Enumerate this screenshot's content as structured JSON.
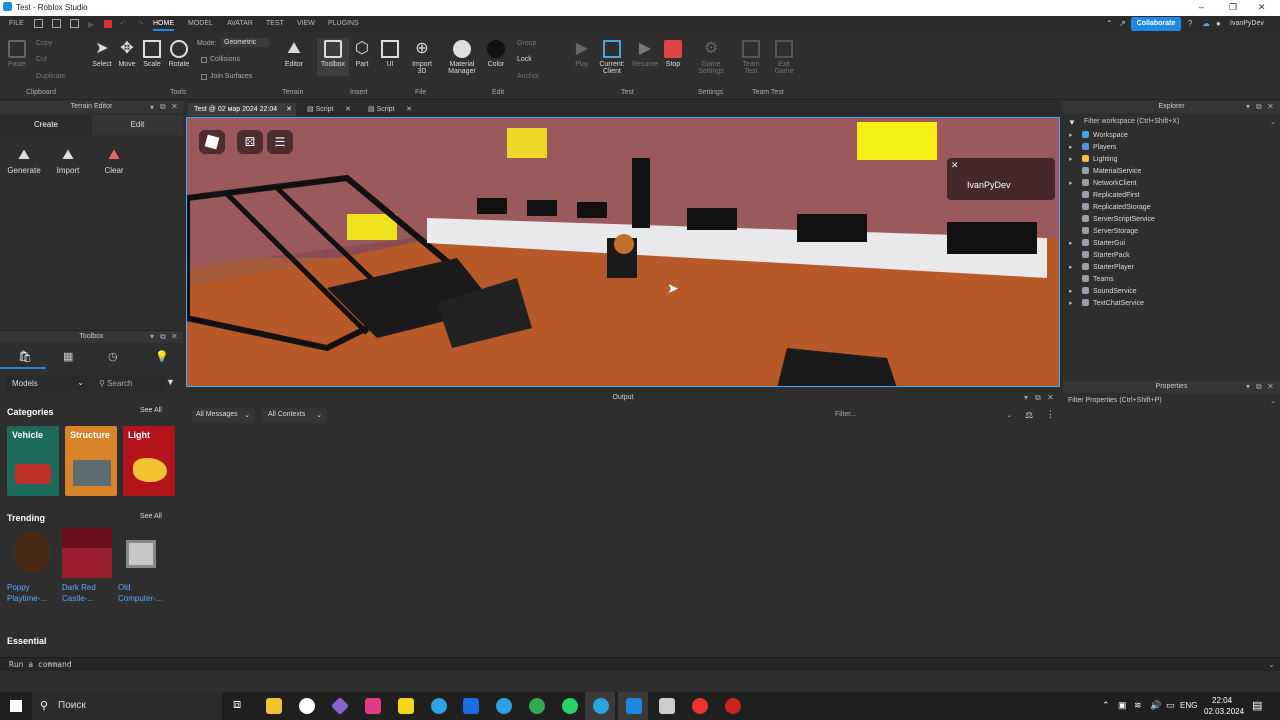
{
  "window": {
    "title": "Test - Roblox Studio",
    "user": "IvanPyDev",
    "collaborate": "Collaborate"
  },
  "menu": [
    "FILE",
    "HOME",
    "MODEL",
    "AVATAR",
    "TEST",
    "VIEW",
    "PLUGINS"
  ],
  "ribbon": {
    "clipboard": {
      "paste": "Paste",
      "copy": "Copy",
      "cut": "Cut",
      "duplicate": "Duplicate",
      "group": "Clipboard"
    },
    "tools": {
      "select": "Select",
      "move": "Move",
      "scale": "Scale",
      "rotate": "Rotate",
      "mode_label": "Mode:",
      "mode_value": "Geometric",
      "collisions": "Collisions",
      "join": "Join Surfaces",
      "group": "Tools"
    },
    "terrain": {
      "editor": "Editor",
      "group": "Terrain"
    },
    "insert": {
      "toolbox": "Toolbox",
      "part": "Part",
      "ui": "UI",
      "group": "Insert"
    },
    "file": {
      "import3d": "Import 3D",
      "group": "File"
    },
    "edit": {
      "material": "Material Manager",
      "color": "Color",
      "group_btn": "Group",
      "lock": "Lock",
      "anchor": "Anchor",
      "group": "Edit"
    },
    "test": {
      "play": "Play",
      "current": "Current: Client",
      "resume": "Resume",
      "stop": "Stop",
      "group": "Test"
    },
    "settings": {
      "game": "Game Settings",
      "group": "Settings"
    },
    "teamtest": {
      "team": "Team Test",
      "exit": "Exit Game",
      "group": "Team Test"
    }
  },
  "terrain_editor": {
    "title": "Terrain Editor",
    "tabs": [
      "Create",
      "Edit"
    ],
    "actions": [
      "Generate",
      "Import",
      "Clear"
    ]
  },
  "toolbox": {
    "title": "Toolbox",
    "category_select": "Models",
    "search_placeholder": "Search",
    "categories_label": "Categories",
    "see_all": "See All",
    "categories": [
      {
        "name": "Vehicle",
        "color": "#1e6b5c"
      },
      {
        "name": "Structure",
        "color": "#d9832b"
      },
      {
        "name": "Light",
        "color": "#b3141c"
      }
    ],
    "trending_label": "Trending",
    "trending": [
      {
        "line1": "Poppy",
        "line2": "Playtime-..."
      },
      {
        "line1": "Dark Red",
        "line2": "Castle-..."
      },
      {
        "line1": "Old",
        "line2": "Computer-..."
      }
    ],
    "essential_label": "Essential"
  },
  "doc_tabs": [
    "Test @ 02 мар 2024 22:04",
    "Script",
    "Script"
  ],
  "viewport": {
    "player_name": "IvanPyDev"
  },
  "output": {
    "title": "Output",
    "filter_messages": "All Messages",
    "filter_contexts": "All Contexts",
    "filter_placeholder": "Filter..."
  },
  "explorer": {
    "title": "Explorer",
    "filter": "Filter workspace (Ctrl+Shift+X)",
    "items": [
      {
        "label": "Workspace",
        "color": "#4aa3df",
        "expand": true
      },
      {
        "label": "Players",
        "color": "#5a8fd8",
        "expand": true
      },
      {
        "label": "Lighting",
        "color": "#f2c230",
        "expand": true
      },
      {
        "label": "MaterialService",
        "color": "#9aa0a6",
        "expand": false
      },
      {
        "label": "NetworkClient",
        "color": "#9aa0a6",
        "expand": true
      },
      {
        "label": "ReplicatedFirst",
        "color": "#9aa0a6",
        "expand": false
      },
      {
        "label": "ReplicatedStorage",
        "color": "#9aa0a6",
        "expand": false
      },
      {
        "label": "ServerScriptService",
        "color": "#9aa0a6",
        "expand": false
      },
      {
        "label": "ServerStorage",
        "color": "#9aa0a6",
        "expand": false
      },
      {
        "label": "StarterGui",
        "color": "#9aa0a6",
        "expand": true
      },
      {
        "label": "StarterPack",
        "color": "#9aa0a6",
        "expand": false
      },
      {
        "label": "StarterPlayer",
        "color": "#9aa0a6",
        "expand": true
      },
      {
        "label": "Teams",
        "color": "#9aa0a6",
        "expand": false
      },
      {
        "label": "SoundService",
        "color": "#9aa0a6",
        "expand": true
      },
      {
        "label": "TextChatService",
        "color": "#9aa0a6",
        "expand": true
      }
    ]
  },
  "properties": {
    "title": "Properties",
    "filter": "Filter Properties (Ctrl+Shift+P)"
  },
  "command_bar": {
    "placeholder": "Run a command"
  },
  "taskbar": {
    "search": "Поиск",
    "lang": "ENG",
    "time": "22:04",
    "date": "02.03.2024"
  }
}
